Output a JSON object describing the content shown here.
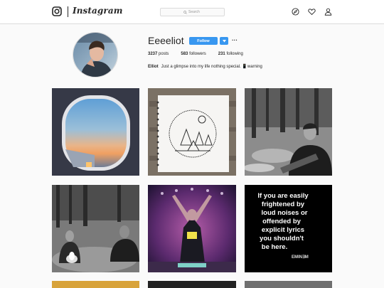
{
  "header": {
    "wordmark": "Instagram",
    "search_placeholder": "Search",
    "icons": [
      "instagram-logo-icon",
      "compass-icon",
      "heart-icon",
      "person-icon"
    ]
  },
  "profile": {
    "username": "Eeeeliot",
    "follow_label": "Follow",
    "more_label": "···",
    "posts_count": "3237",
    "posts_label": "posts",
    "followers_count": "583",
    "followers_label": "followers",
    "following_count": "231",
    "following_label": "following",
    "full_name": "Elliot",
    "bio": "Just a glimpse into my life nothing special. 📱warning"
  },
  "posts": [
    {
      "description": "airplane-window-sunset-photo"
    },
    {
      "description": "sketchbook-drawing-photo"
    },
    {
      "description": "man-with-guitar-photo"
    },
    {
      "description": "campfire-group-photo"
    },
    {
      "description": "concert-performer-photo"
    },
    {
      "description": "text-note-photo",
      "text": "If you are easily frightened by loud noises or offended by explicit lyrics you shouldn't be here.",
      "signature": "EMINEM"
    },
    {
      "description": "partial-photo-yellow"
    },
    {
      "description": "partial-photo-dark"
    },
    {
      "description": "partial-photo-gray"
    }
  ],
  "colors": {
    "accent": "#3897f0",
    "text": "#262626",
    "border": "#dbdbdb",
    "background": "#fafafa"
  }
}
